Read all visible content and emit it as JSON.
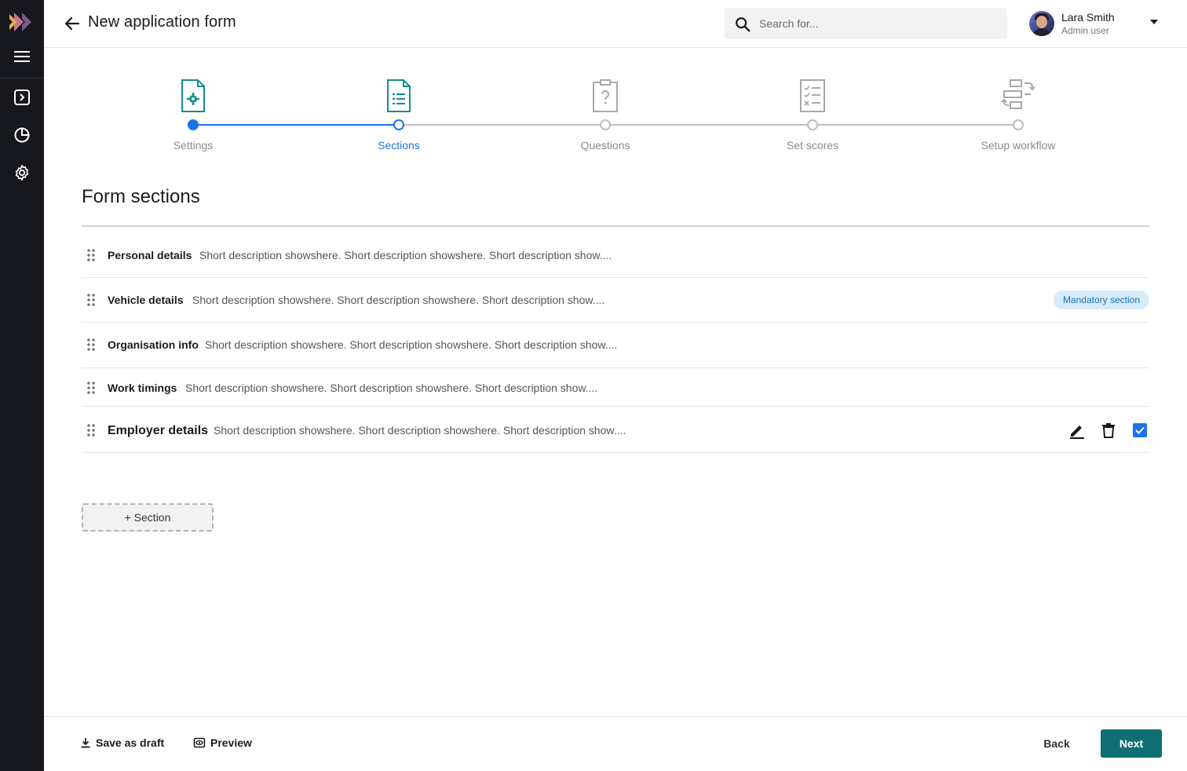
{
  "colors": {
    "rail_bg": "#16181d",
    "accent_blue": "#1a73e8",
    "teal": "#0f6f73",
    "badge_bg": "#d6ecfb",
    "badge_text": "#1e6fb0"
  },
  "header": {
    "title": "New application form",
    "search_placeholder": "Search for...",
    "user": {
      "name": "Lara Smith",
      "role": "Admin user"
    }
  },
  "rail": {
    "items": [
      "menu-icon",
      "forms-icon",
      "analytics-icon",
      "settings-icon"
    ]
  },
  "stepper": {
    "steps": [
      {
        "label": "Settings",
        "state": "completed",
        "icon": "doc-gear-icon"
      },
      {
        "label": "Sections",
        "state": "active",
        "icon": "doc-list-icon"
      },
      {
        "label": "Questions",
        "state": "pending",
        "icon": "clipboard-question-icon"
      },
      {
        "label": "Set scores",
        "state": "pending",
        "icon": "checklist-icon"
      },
      {
        "label": "Setup workflow",
        "state": "pending",
        "icon": "workflow-icon"
      }
    ]
  },
  "main": {
    "title": "Form sections",
    "sections": [
      {
        "name": "Personal details",
        "description": "Short description showshere. Short description showshere. Short description show....",
        "badge": ""
      },
      {
        "name": "Vehicle details",
        "description": "Short description showshere. Short description showshere. Short description show....",
        "badge": "Mandatory section"
      },
      {
        "name": "Organisation info",
        "description": "Short description showshere. Short description showshere. Short description show....",
        "badge": ""
      },
      {
        "name": "Work timings",
        "description": "Short description showshere. Short description showshere. Short description show....",
        "badge": ""
      },
      {
        "name": "Employer details",
        "description": "Short description showshere. Short description showshere. Short description show....",
        "badge": "",
        "selected": true
      }
    ],
    "add_section_label": "+ Section"
  },
  "footer": {
    "save_draft_label": "Save as draft",
    "preview_label": "Preview",
    "back_label": "Back",
    "next_label": "Next"
  }
}
